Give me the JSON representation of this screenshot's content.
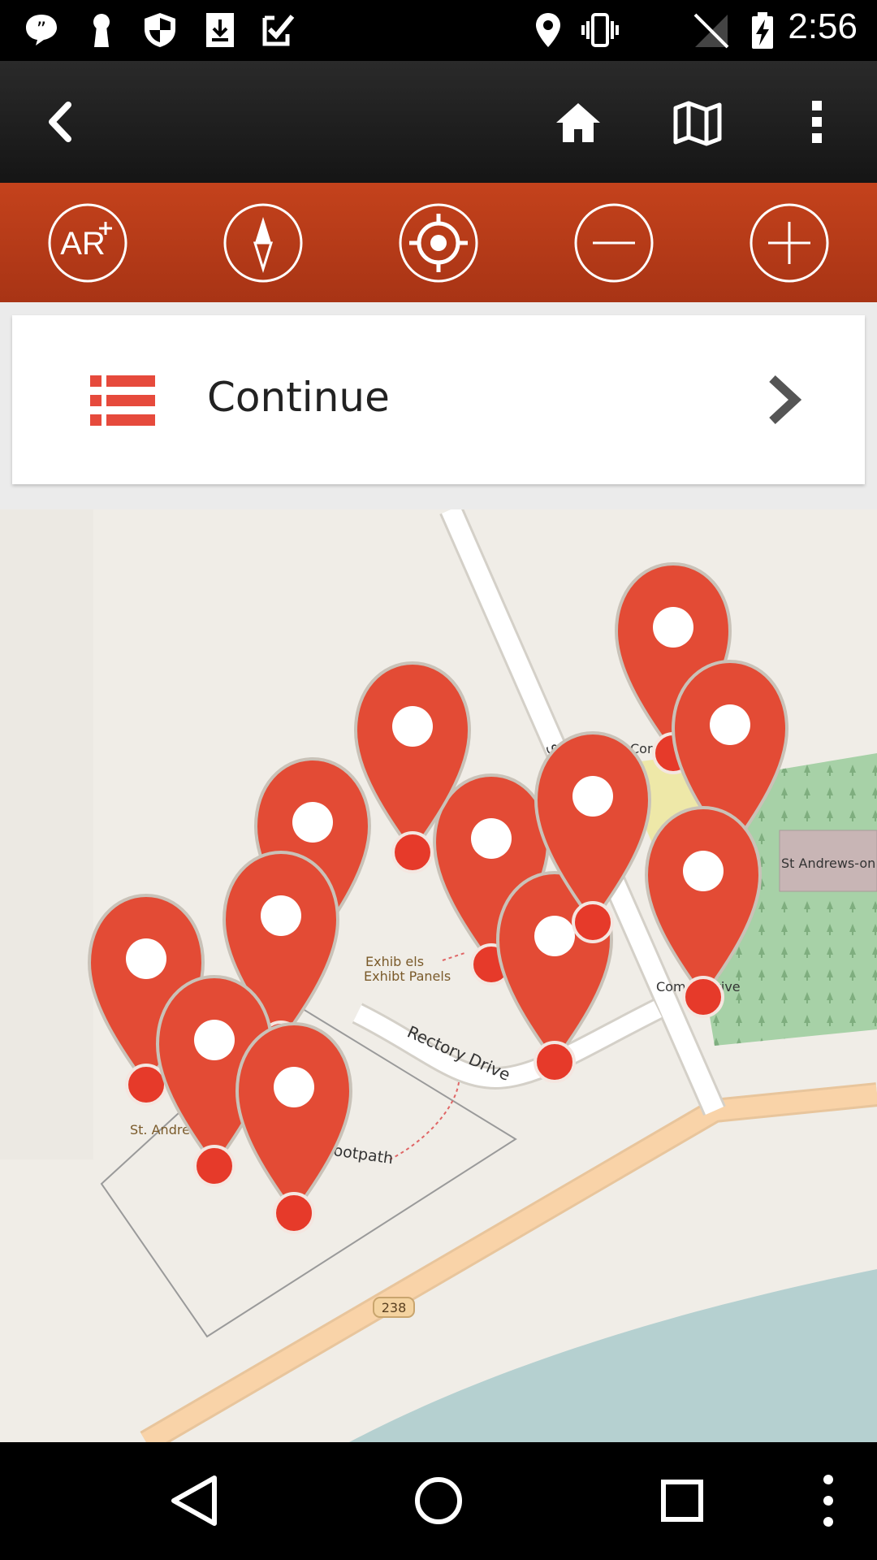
{
  "status_bar": {
    "time": "2:56",
    "left_icons": [
      "quote-notification-icon",
      "keyhole-icon",
      "shield-icon",
      "download-icon",
      "checkmark-icon"
    ],
    "right_icons": [
      "location-icon",
      "vibrate-icon",
      "no-signal-icon",
      "battery-charging-icon"
    ]
  },
  "app_bar": {
    "back_icon": "chevron-left-icon",
    "actions": [
      "home-icon",
      "map-icon",
      "more-vert-icon"
    ]
  },
  "map_controls": [
    {
      "name": "ar-button",
      "icon": "ar-plus-icon",
      "text": "AR"
    },
    {
      "name": "compass-button",
      "icon": "compass-icon"
    },
    {
      "name": "my-location-button",
      "icon": "target-icon"
    },
    {
      "name": "zoom-out-button",
      "icon": "minus-icon"
    },
    {
      "name": "zoom-in-button",
      "icon": "plus-icon"
    }
  ],
  "continue_card": {
    "label": "Continue",
    "list_icon_color": "#e64a3c"
  },
  "map": {
    "labels": {
      "rectory_drive": "Rectory Drive",
      "footpath": "ootpath",
      "exhibit_panels_1": "Exhib    els",
      "exhibit_panels_2": "Exhibt Panels",
      "st_andrews_left": "St. Andre",
      "st_andrews_right": "St Andrews-on",
      "commemorative": "Comm       rative",
      "cor": "Cor",
      "street": "St",
      "route": "238"
    },
    "colors": {
      "pin": "#e34b35",
      "land": "#f0ede7",
      "water": "#b5d0d0",
      "road": "#f9d3a8",
      "park": "#a7d1a7"
    }
  },
  "nav_bar": {
    "buttons": [
      "back-triangle-icon",
      "home-circle-icon",
      "recents-square-icon",
      "more-dots-icon"
    ]
  }
}
